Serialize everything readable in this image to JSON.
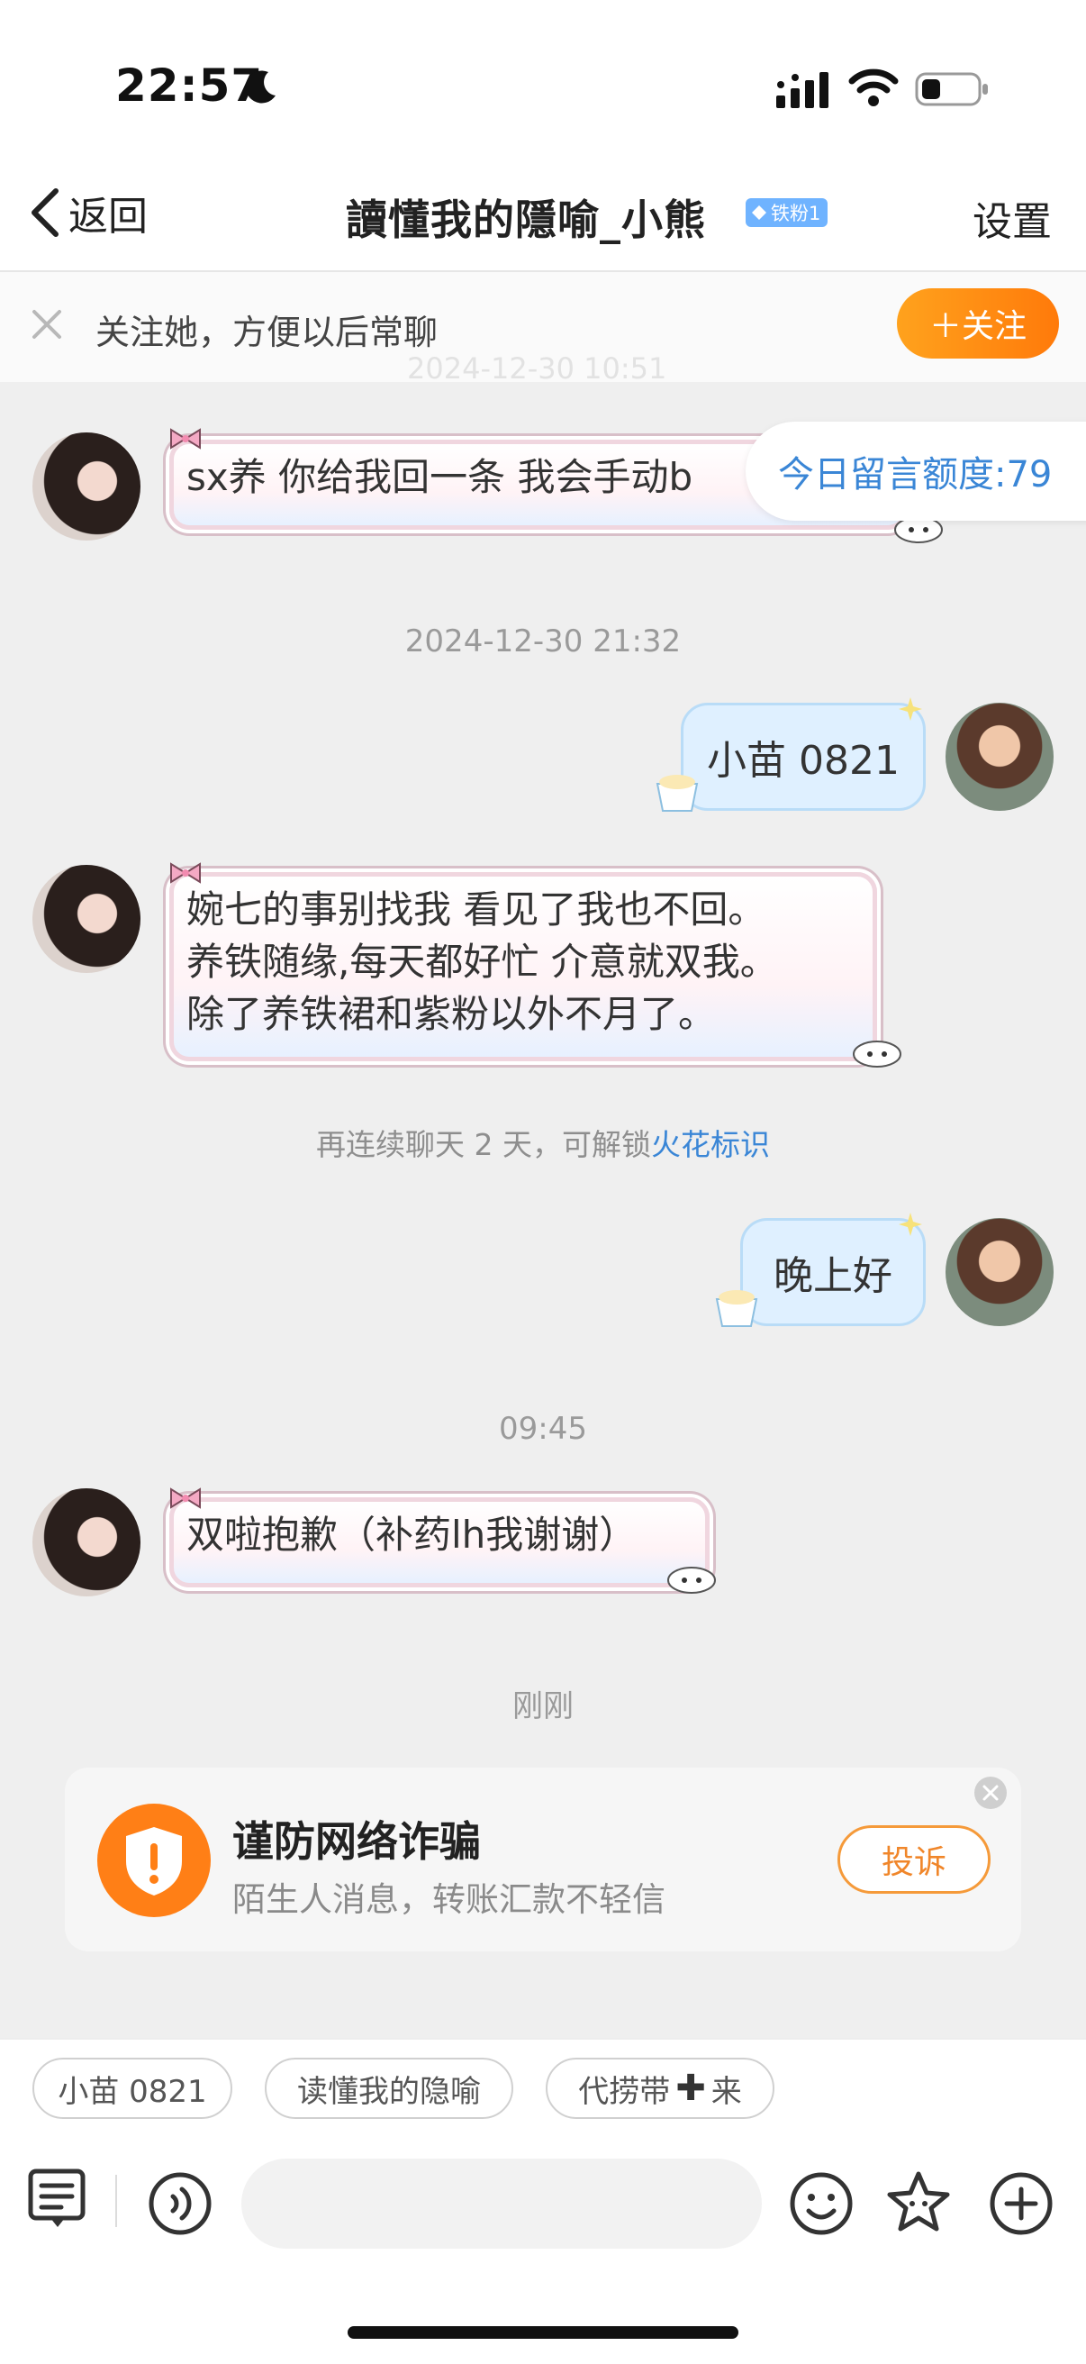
{
  "status_bar": {
    "time": "22:57"
  },
  "header": {
    "back_label": "返回",
    "title": "讀懂我的隱喻_小熊",
    "badge": "铁粉1",
    "settings_label": "设置"
  },
  "follow_bar": {
    "text": "关注她，方便以后常聊",
    "button_label": "＋关注",
    "partial_timestamp": "2024-12-30 10:51"
  },
  "quota": {
    "text": "今日留言额度:79"
  },
  "messages": [
    {
      "from": "her",
      "text": "sx养 你给我回一条 我会手动b"
    },
    {
      "timestamp": "2024-12-30 21:32"
    },
    {
      "from": "me",
      "text": "小苗 0821"
    },
    {
      "from": "her",
      "lines": [
        "婉七的事别找我 看见了我也不回。",
        "养铁随缘,每天都好忙 介意就双我。",
        "除了养铁裙和紫粉以外不月了。"
      ]
    },
    {
      "from": "me",
      "text": "晚上好"
    },
    {
      "timestamp": "09:45"
    },
    {
      "from": "her",
      "text": "双啦抱歉（补药lh我谢谢）"
    },
    {
      "timestamp": "刚刚"
    }
  ],
  "spark_tip": {
    "prefix": "再连续聊天 2 天，可解锁",
    "link": "火花标识"
  },
  "fraud_card": {
    "title": "谨防网络诈骗",
    "subtitle": "陌生人消息，转账汇款不轻信",
    "button_label": "投诉",
    "icon": "shield-alert-icon"
  },
  "quick_replies": [
    "小苗 0821",
    "读懂我的隐喻",
    "代捞带",
    "来"
  ],
  "toolbar": {
    "icons": [
      "message-list-icon",
      "voice-icon",
      "emoji-icon",
      "star-sticker-icon",
      "plus-icon"
    ]
  },
  "colors": {
    "accent_orange": "#ff8a10",
    "link_blue": "#3a86d6",
    "self_bubble": "#dff0ff"
  }
}
